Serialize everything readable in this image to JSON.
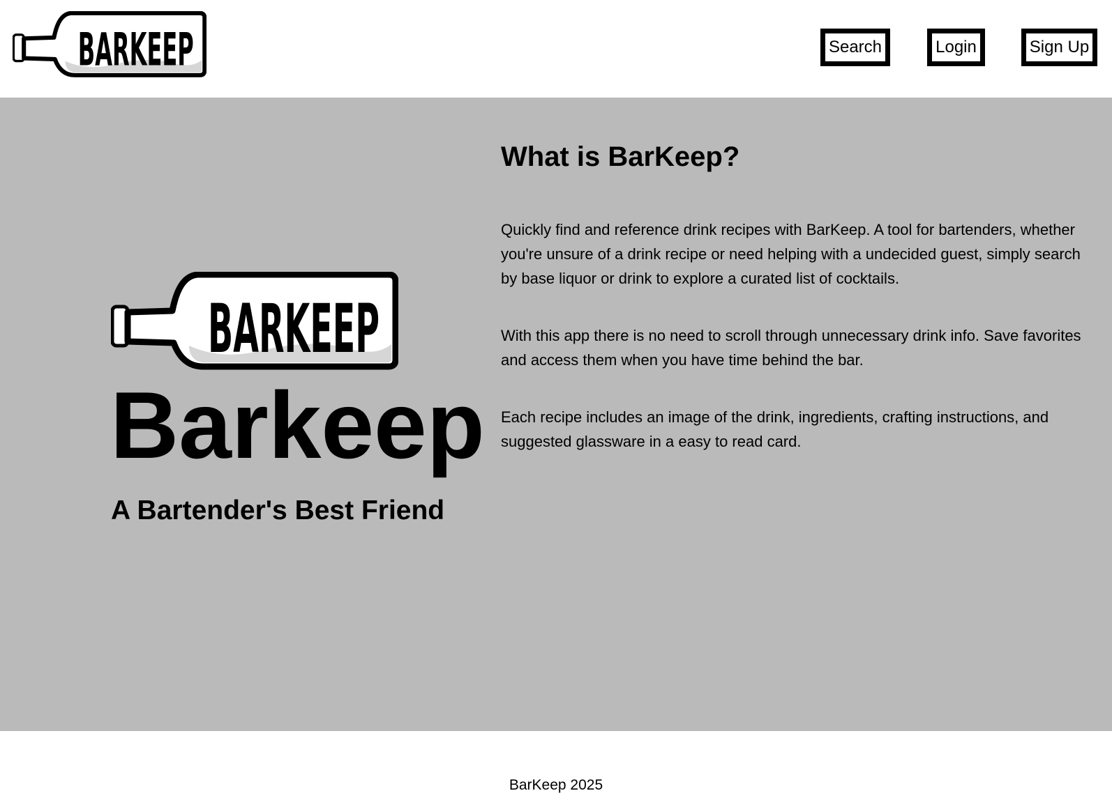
{
  "header": {
    "logo_text": "BARKEEP",
    "nav": {
      "search_label": "Search",
      "login_label": "Login",
      "signup_label": "Sign Up"
    }
  },
  "hero": {
    "logo_text": "BARKEEP",
    "title": "Barkeep",
    "tagline": "A Bartender's Best Friend"
  },
  "about": {
    "heading": "What is BarKeep?",
    "paragraphs": [
      "Quickly find and reference drink recipes with BarKeep. A tool for bartenders, whether you're unsure of a drink recipe or need helping with a undecided guest, simply search by base liquor or drink to explore a curated list of cocktails.",
      "With this app there is no need to scroll through unnecessary drink info. Save favorites and access them when you have time behind the bar.",
      "Each recipe includes an image of the drink, ingredients, crafting instructions, and suggested glassware in a easy to read card."
    ]
  },
  "footer": {
    "text": "BarKeep 2025"
  },
  "colors": {
    "hero_background": "#bababa",
    "page_background": "#ffffff",
    "text": "#000000"
  }
}
